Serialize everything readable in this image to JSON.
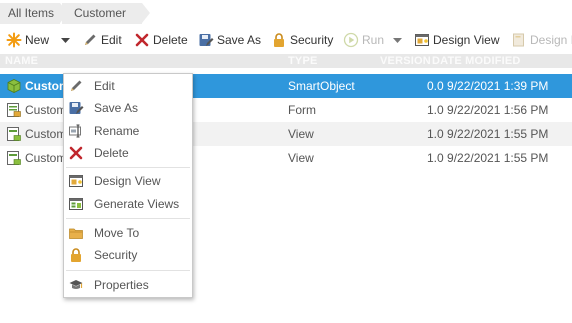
{
  "breadcrumb": {
    "items": [
      "All Items",
      "Customer"
    ]
  },
  "toolbar": {
    "new": "New",
    "edit": "Edit",
    "delete": "Delete",
    "save_as": "Save As",
    "security": "Security",
    "run": "Run",
    "design_view": "Design View",
    "design_f": "Design F"
  },
  "table": {
    "columns": [
      "NAME",
      "TYPE",
      "VERSION",
      "DATE MODIFIED"
    ],
    "rows": [
      {
        "name": "Custom",
        "type": "SmartObject",
        "version_date": "0.0 9/22/2021 1:39 PM",
        "icon": "smartobject-icon"
      },
      {
        "name": "Custom",
        "type": "Form",
        "version_date": "1.0 9/22/2021 1:56 PM",
        "icon": "form-icon"
      },
      {
        "name": "Custom",
        "type": "View",
        "version_date": "1.0 9/22/2021 1:55 PM",
        "icon": "view-icon"
      },
      {
        "name": "Custom",
        "type": "View",
        "version_date": "1.0 9/22/2021 1:55 PM",
        "icon": "view-icon"
      }
    ]
  },
  "context_menu": {
    "items": [
      {
        "label": "Edit",
        "icon": "pencil-icon"
      },
      {
        "label": "Save As",
        "icon": "save-as-icon"
      },
      {
        "label": "Rename",
        "icon": "rename-icon"
      },
      {
        "label": "Delete",
        "icon": "delete-x-icon"
      },
      {
        "label": "Design View",
        "icon": "design-view-icon"
      },
      {
        "label": "Generate Views",
        "icon": "generate-views-icon"
      },
      {
        "label": "Move To",
        "icon": "folder-move-icon"
      },
      {
        "label": "Security",
        "icon": "lock-icon"
      },
      {
        "label": "Properties",
        "icon": "properties-icon"
      }
    ]
  },
  "colors": {
    "selection": "#2f97dc",
    "delete_red": "#c0272d",
    "new_orange": "#f39c12"
  }
}
